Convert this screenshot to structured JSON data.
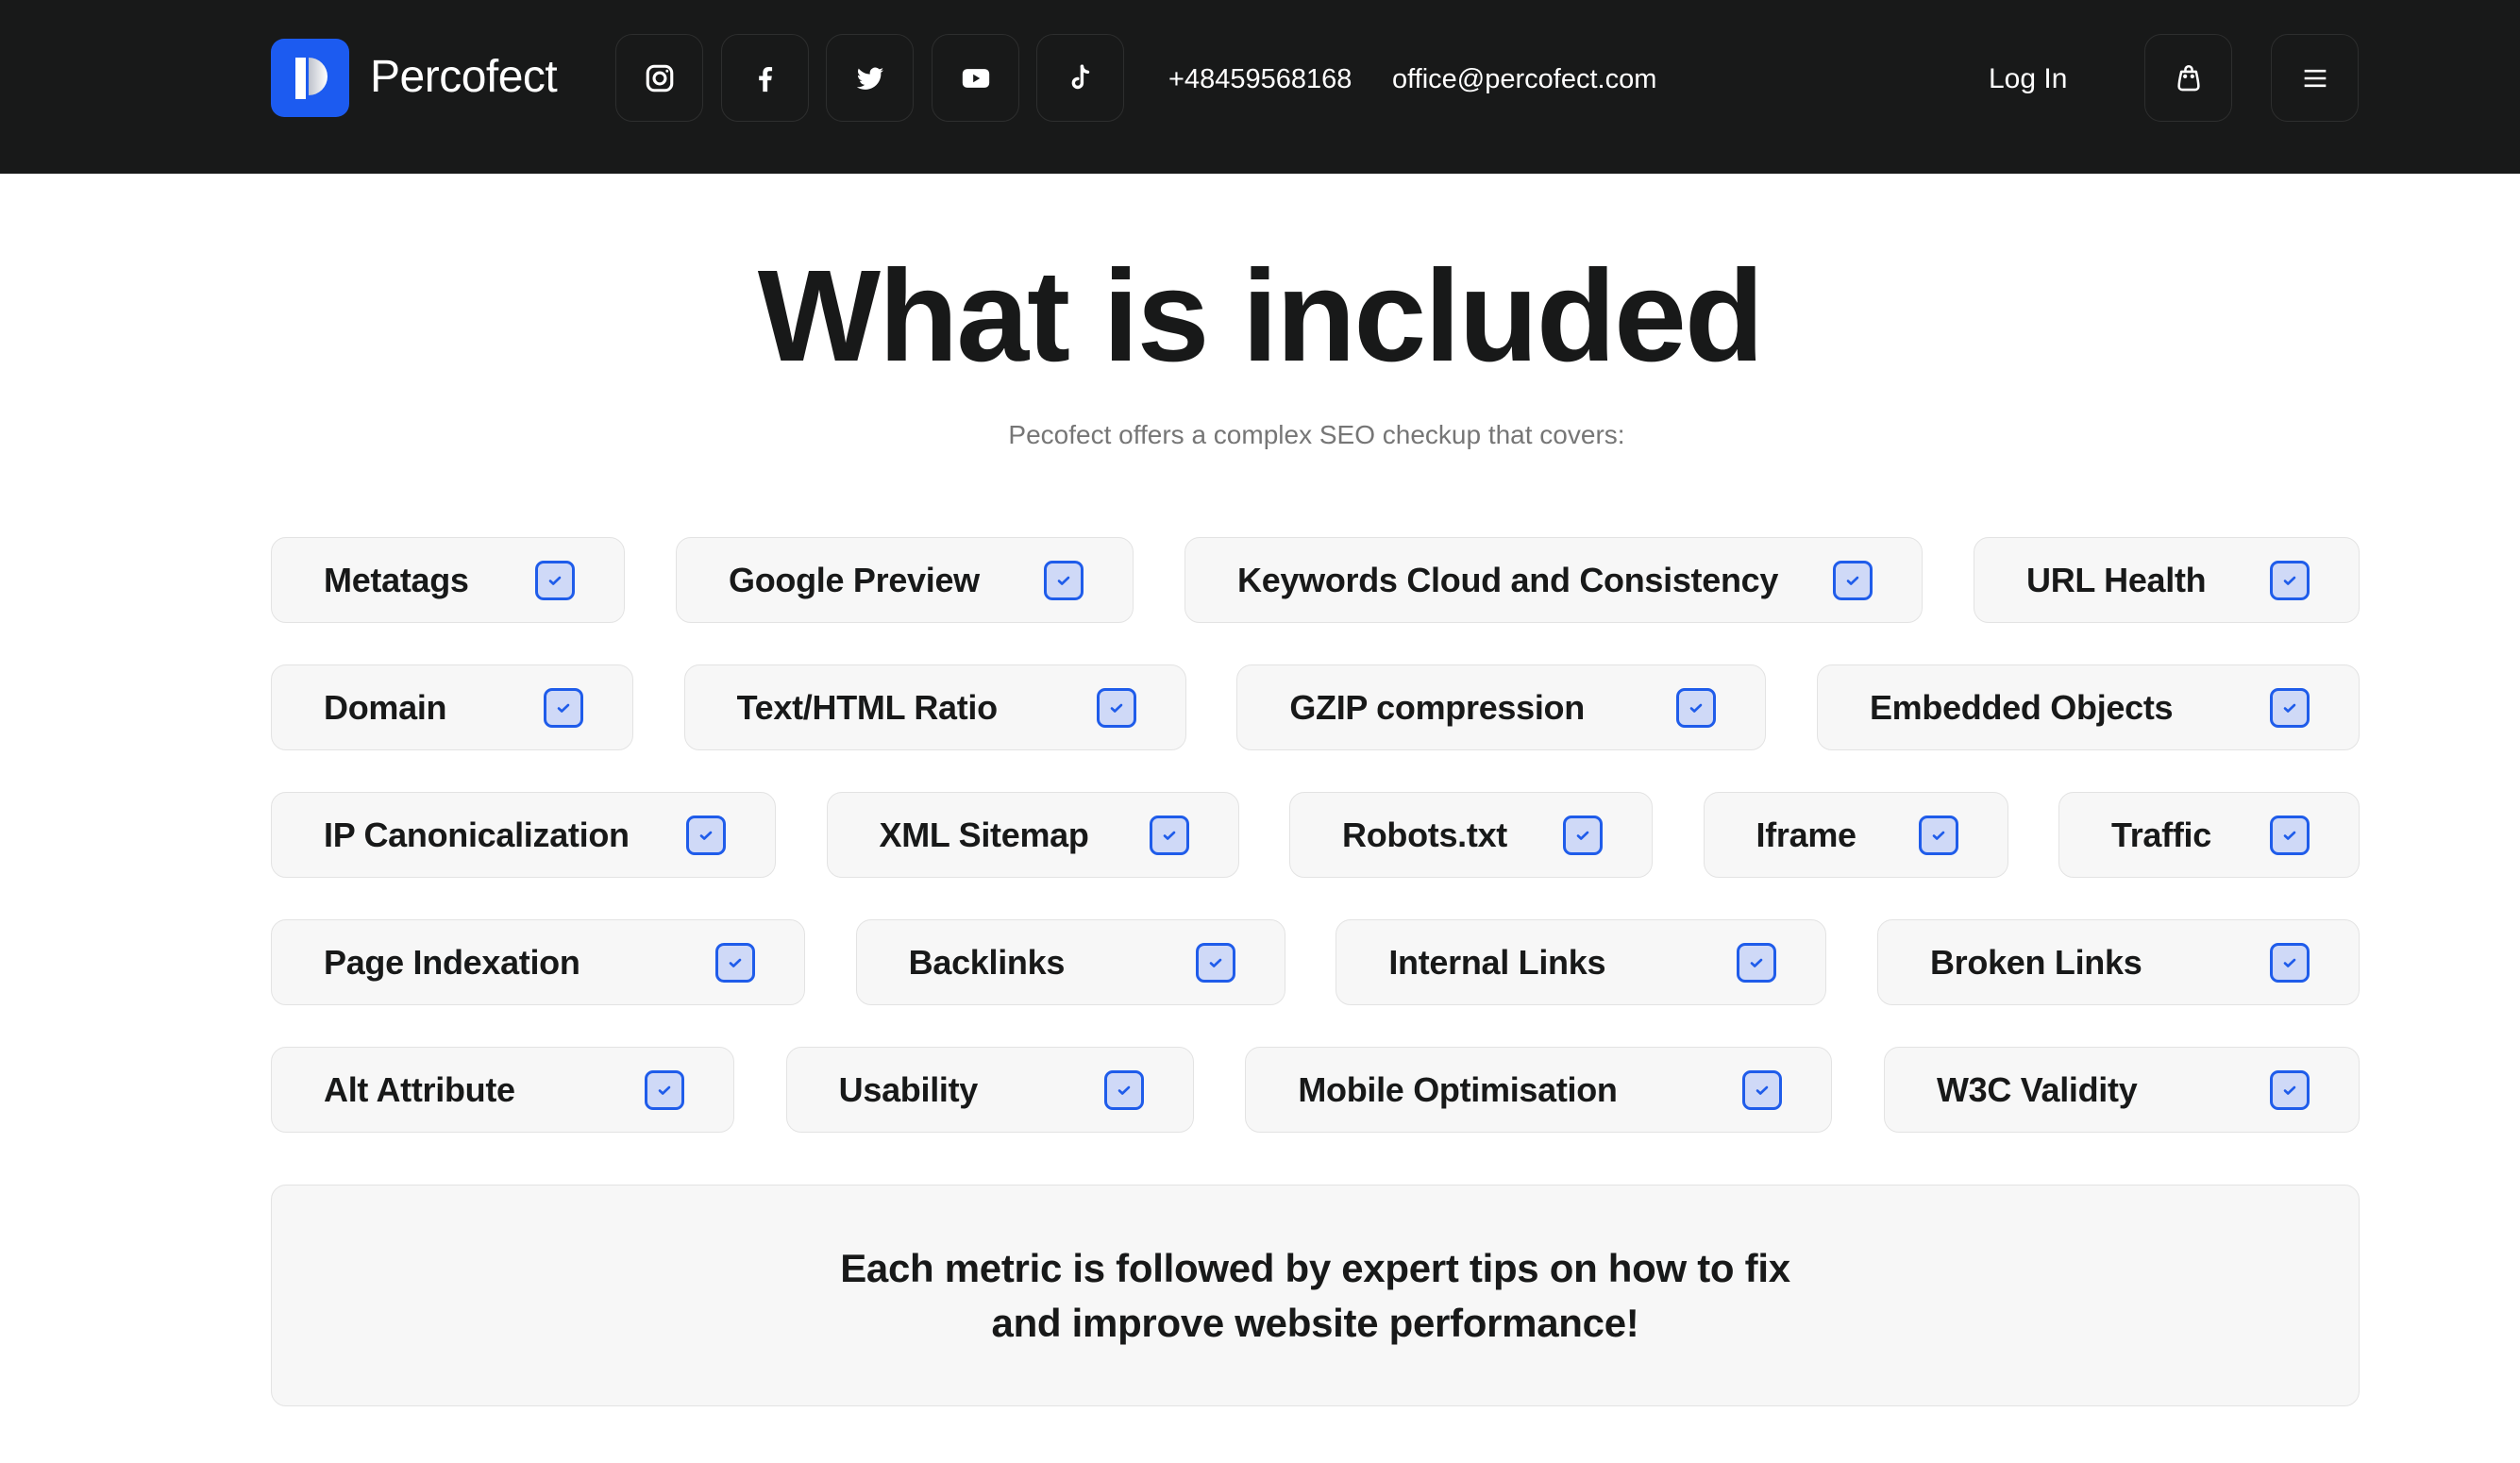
{
  "header": {
    "brand": "Percofect",
    "social": [
      {
        "name": "instagram",
        "icon": "instagram-icon"
      },
      {
        "name": "facebook",
        "icon": "facebook-icon"
      },
      {
        "name": "twitter",
        "icon": "twitter-icon"
      },
      {
        "name": "youtube",
        "icon": "youtube-icon"
      },
      {
        "name": "tiktok",
        "icon": "tiktok-icon"
      }
    ],
    "phone": "+48459568168",
    "email": "office@percofect.com",
    "login_label": "Log In",
    "cart_icon": "shopping-bag-icon",
    "menu_icon": "hamburger-menu-icon"
  },
  "hero": {
    "title": "What is included",
    "subtitle": "Pecofect offers a complex SEO checkup that covers:"
  },
  "colors": {
    "header_bg": "#181919",
    "brand_blue": "#1c5bf0",
    "check_border": "#1f5cea",
    "check_fill": "#cfd9f7",
    "tag_bg": "#f7f7f7"
  },
  "features": [
    [
      {
        "label": "Metatags",
        "checked": true
      },
      {
        "label": "Google Preview",
        "checked": true
      },
      {
        "label": "Keywords Cloud and Consistency",
        "checked": true
      },
      {
        "label": "URL Health",
        "checked": true
      }
    ],
    [
      {
        "label": "Domain",
        "checked": true
      },
      {
        "label": "Text/HTML Ratio",
        "checked": true
      },
      {
        "label": "GZIP compression",
        "checked": true
      },
      {
        "label": "Embedded Objects",
        "checked": true
      }
    ],
    [
      {
        "label": "IP Canonicalization",
        "checked": true
      },
      {
        "label": "XML Sitemap",
        "checked": true
      },
      {
        "label": "Robots.txt",
        "checked": true
      },
      {
        "label": "Iframe",
        "checked": true
      },
      {
        "label": "Traffic",
        "checked": true
      }
    ],
    [
      {
        "label": "Page Indexation",
        "checked": true
      },
      {
        "label": "Backlinks",
        "checked": true
      },
      {
        "label": "Internal Links",
        "checked": true
      },
      {
        "label": "Broken Links",
        "checked": true
      }
    ],
    [
      {
        "label": "Alt Attribute",
        "checked": true
      },
      {
        "label": "Usability",
        "checked": true
      },
      {
        "label": "Mobile Optimisation",
        "checked": true
      },
      {
        "label": "W3C Validity",
        "checked": true
      }
    ]
  ],
  "callout": {
    "line1": "Each metric is followed by expert tips on how to fix",
    "line2": "and improve website performance!"
  }
}
